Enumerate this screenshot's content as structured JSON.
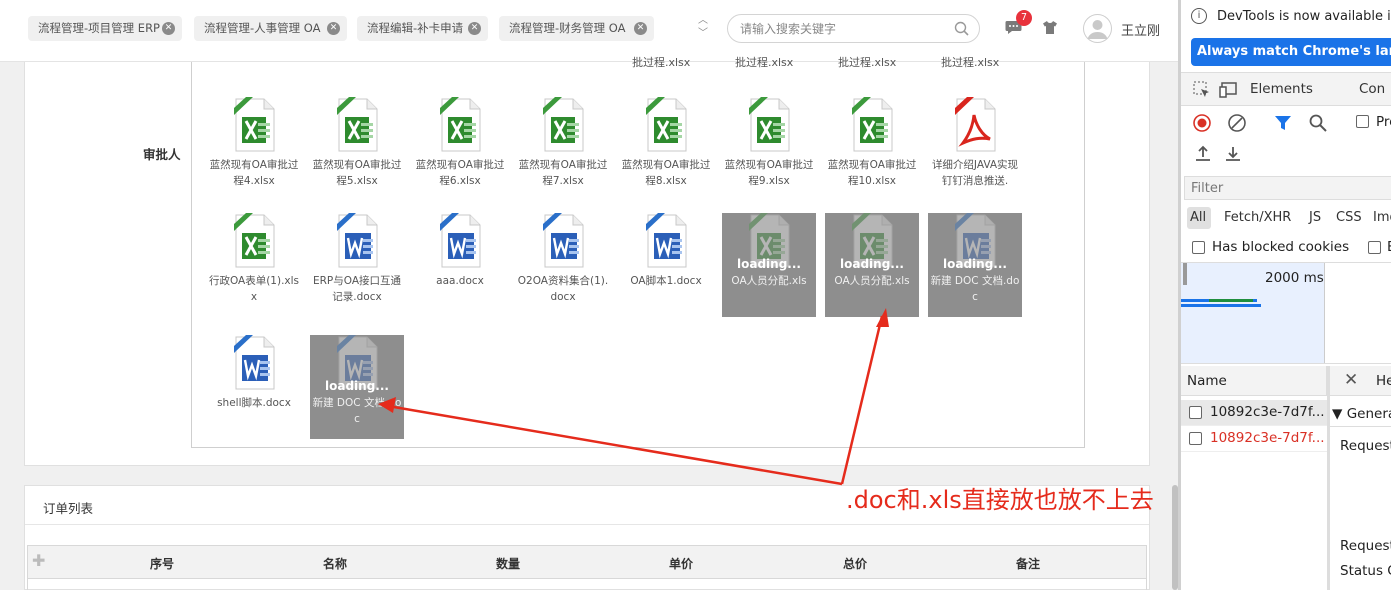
{
  "tabs": [
    {
      "label": "流程管理-项目管理 ERP"
    },
    {
      "label": "流程管理-人事管理 OA"
    },
    {
      "label": "流程编辑-补卡申请"
    },
    {
      "label": "流程管理-财务管理 OA"
    }
  ],
  "search": {
    "placeholder": "请输入搜索关键字"
  },
  "header": {
    "badge_count": "7",
    "username": "王立刚"
  },
  "form": {
    "approver_label": "审批人",
    "cut_off_labels": [
      "批过程.xlsx",
      "批过程.xlsx",
      "批过程.xlsx",
      "批过程.xlsx"
    ],
    "loading_text": "loading...",
    "files": [
      {
        "type": "xlsx",
        "name": "蓝然现有OA审批过程4.xlsx",
        "loading": false
      },
      {
        "type": "xlsx",
        "name": "蓝然现有OA审批过程5.xlsx",
        "loading": false
      },
      {
        "type": "xlsx",
        "name": "蓝然现有OA审批过程6.xlsx",
        "loading": false
      },
      {
        "type": "xlsx",
        "name": "蓝然现有OA审批过程7.xlsx",
        "loading": false
      },
      {
        "type": "xlsx",
        "name": "蓝然现有OA审批过程8.xlsx",
        "loading": false
      },
      {
        "type": "xlsx",
        "name": "蓝然现有OA审批过程9.xlsx",
        "loading": false
      },
      {
        "type": "xlsx",
        "name": "蓝然现有OA审批过程10.xlsx",
        "loading": false
      },
      {
        "type": "pdf",
        "name": "详细介绍JAVA实现钉钉消息推送.",
        "loading": false
      },
      {
        "type": "xlsx",
        "name": "行政OA表单(1).xlsx",
        "loading": false
      },
      {
        "type": "docx",
        "name": "ERP与OA接口互通记录.docx",
        "loading": false
      },
      {
        "type": "docx",
        "name": "aaa.docx",
        "loading": false
      },
      {
        "type": "docx",
        "name": "O2OA资料集合(1).docx",
        "loading": false
      },
      {
        "type": "docx",
        "name": "OA脚本1.docx",
        "loading": false
      },
      {
        "type": "xlsx",
        "name": "OA人员分配.xls",
        "loading": true
      },
      {
        "type": "xlsx",
        "name": "OA人员分配.xls",
        "loading": true
      },
      {
        "type": "docx",
        "name": "新建 DOC 文档.doc",
        "loading": true
      },
      {
        "type": "docx",
        "name": "shell脚本.docx",
        "loading": false
      },
      {
        "type": "docx",
        "name": "新建 DOC 文档.doc",
        "loading": true
      }
    ]
  },
  "order": {
    "title": "订单列表",
    "columns": [
      "序号",
      "名称",
      "数量",
      "单价",
      "总价",
      "备注"
    ]
  },
  "annotation": {
    "text": ".doc和.xls直接放也放不上去",
    "color": "#e52b1c"
  },
  "devtools": {
    "info_text": "DevTools is now available in",
    "language_button": "Always match Chrome's language",
    "tabs": [
      "Elements",
      "Con"
    ],
    "preserve_label": "Pre",
    "filter_placeholder": "Filter",
    "type_filters": [
      "All",
      "Fetch/XHR",
      "JS",
      "CSS",
      "Img"
    ],
    "blocked_cookies_label": "Has blocked cookies",
    "blocked_requests_label": "B",
    "timeline_label": "2000 ms",
    "name_header": "Name",
    "detail_tab": "He",
    "general_label": "Genera",
    "requests": [
      {
        "name": "10892c3e-7d7f...",
        "error": false
      },
      {
        "name": "10892c3e-7d7f...",
        "error": true
      }
    ],
    "detail_rows": [
      "Request",
      "Request",
      "Status C"
    ]
  },
  "colors": {
    "accent_blue": "#1a73e8",
    "error_red": "#d93025",
    "badge_red": "#e8323c",
    "loading_gray": "#8e8e8e"
  }
}
